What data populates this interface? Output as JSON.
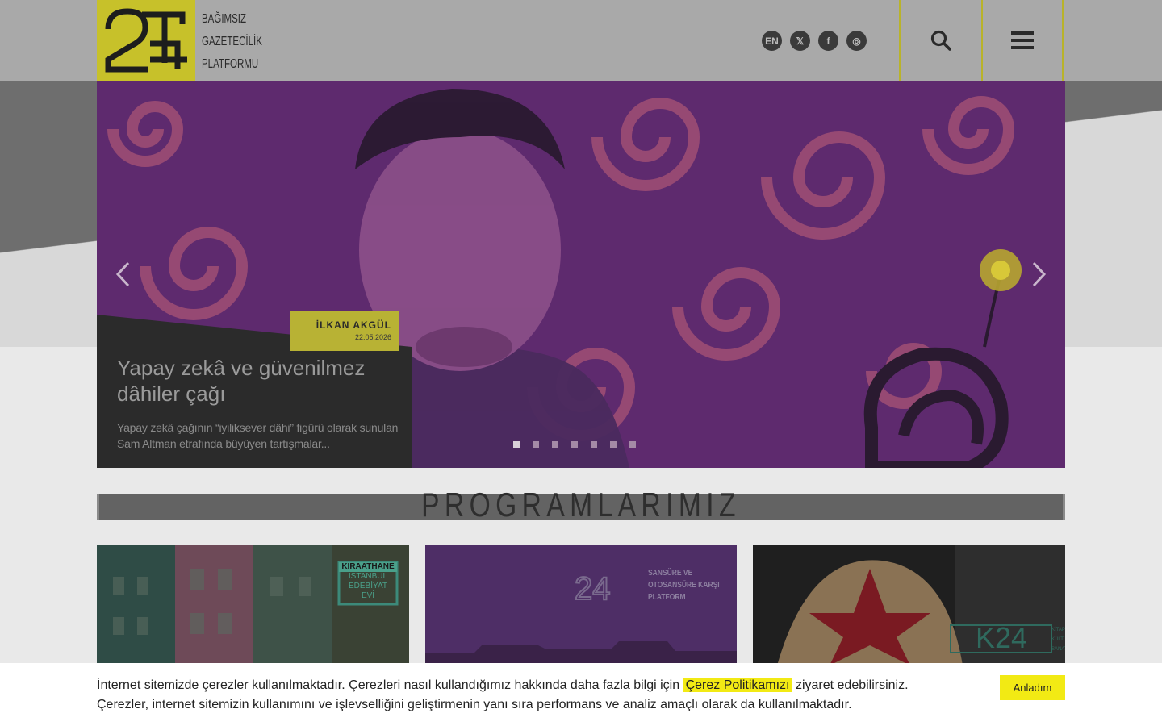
{
  "header": {
    "logo_lines": [
      "BAĞIMSIZ",
      "GAZETECİLİK",
      "PLATFORMU"
    ],
    "social": [
      {
        "name": "en-icon",
        "label": "EN"
      },
      {
        "name": "x-icon",
        "label": "𝕏"
      },
      {
        "name": "facebook-icon",
        "label": "f"
      },
      {
        "name": "instagram-icon",
        "label": "◎"
      }
    ]
  },
  "slider": {
    "author": "İLKAN AKGÜL",
    "date": "22.05.2026",
    "title": "Yapay zekâ ve güvenilmez dâhiler çağı",
    "description": "Yapay zekâ çağının “iyiliksever dâhi” figürü olarak sunulan Sam Altman etrafında büyüyen tartışmalar...",
    "dot_count": 7,
    "active_dot": 0
  },
  "programs": {
    "title": "PROGRAMLARIMIZ",
    "cards": [
      {
        "name": "kiraathane-card",
        "lines": [
          "KIRAATHANE",
          "İSTANBUL",
          "EDEBİYAT",
          "EVİ"
        ]
      },
      {
        "name": "susma-card",
        "lines": [
          "SANSÜRE VE",
          "OTOSANSÜRE KARŞI",
          "PLATFORM"
        ]
      },
      {
        "name": "k24-card",
        "lines": [
          "K24",
          "KİTAP",
          "KÜLTÜR",
          "SANAT"
        ]
      }
    ]
  },
  "cookie": {
    "text_before": "İnternet sitemizde çerezler kullanılmaktadır. Çerezleri nasıl kullandığımız hakkında daha fazla bilgi için ",
    "link": "Çerez Politikamızı",
    "text_after": " ziyaret edebilirsiniz.",
    "line2": "Çerezler, internet sitemizin kullanımını ve işlevselliğini geliştirmenin yanı sıra performans ve analiz amaçlı olarak da kullanılmaktadır.",
    "button": "Anladım"
  },
  "colors": {
    "brand_yellow": "#f2ea14",
    "slider_purple": "#5e2a6e",
    "swirl_red": "#b5505e"
  }
}
